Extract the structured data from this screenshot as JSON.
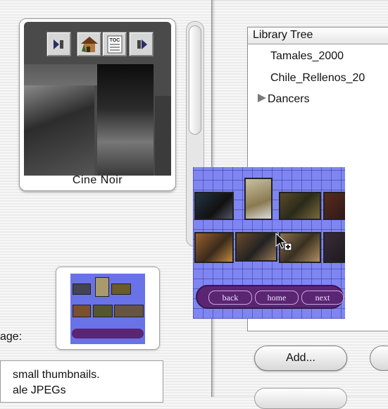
{
  "theme_card": {
    "theme_name": "Cine Noir",
    "nav_buttons": [
      {
        "name": "previous-theme-button",
        "icon": "left-arrow-icon"
      },
      {
        "name": "home-theme-button",
        "icon": "house-icon"
      },
      {
        "name": "toc-theme-button",
        "icon": "toc-icon",
        "label": "TOC"
      },
      {
        "name": "next-theme-button",
        "icon": "right-arrow-icon"
      }
    ]
  },
  "page_label": "age:",
  "description": {
    "line1": "small thumbnails.",
    "line2": "ale JPEGs"
  },
  "library_tree": {
    "header": "Library Tree",
    "items": [
      {
        "label": "Tamales_2000",
        "has_children": false
      },
      {
        "label": "Chile_Rellenos_20",
        "has_children": false
      },
      {
        "label": "Dancers",
        "has_children": true
      }
    ]
  },
  "buttons": {
    "add": "Add..."
  },
  "drag_preview": {
    "nav": {
      "back": "back",
      "home": "home",
      "next": "next"
    }
  },
  "colors": {
    "pattern_blue": "#7f86f2",
    "nav_purple": "#5a2572"
  }
}
